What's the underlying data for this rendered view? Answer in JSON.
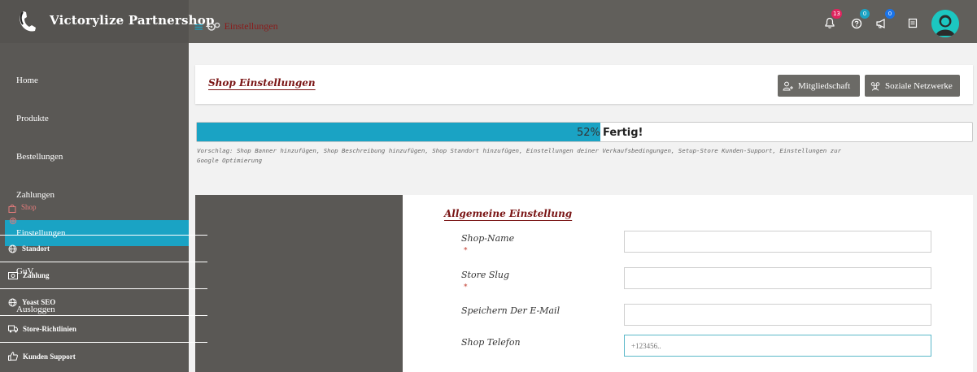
{
  "topbar": {
    "brand_name": "Victorylize Partnershop",
    "breadcrumb": "Einstellungen",
    "icons": [
      {
        "name": "bell-icon",
        "badge": "13",
        "badge_color": "#e0245e"
      },
      {
        "name": "help-icon",
        "badge": "0",
        "badge_color": "#1aa3c4"
      },
      {
        "name": "megaphone-icon",
        "badge": "0",
        "badge_color": "#1a73e8"
      },
      {
        "name": "notes-icon",
        "badge": ""
      }
    ]
  },
  "sidebar": {
    "items": [
      {
        "label": "Home"
      },
      {
        "label": "Produkte"
      },
      {
        "label": "Bestellungen"
      },
      {
        "label": "Zahlungen"
      },
      {
        "label": "Einstellungen",
        "active": true
      },
      {
        "label": "GuV"
      },
      {
        "label": "Ausloggen"
      }
    ]
  },
  "header": {
    "title": "Shop Einstellungen",
    "buttons": [
      {
        "label": "Mitgliedschaft",
        "icon": "user-plus-icon"
      },
      {
        "label": "Soziale Netzwerke",
        "icon": "group-icon"
      }
    ]
  },
  "progress": {
    "percent": 52,
    "percent_text": "52%",
    "label": "Fertig!",
    "hint": "Vorschlag: Shop Banner hinzufügen, Shop Beschreibung hinzufügen, Shop Standort hinzufügen, Einstellungen deiner Verkaufsbedingungen, Setup-Store Kunden-Support, Einstellungen zur Google Optimierung"
  },
  "settings_menu": {
    "items": [
      {
        "label": "Shop",
        "icon": "bag-icon",
        "active": true
      },
      {
        "label": "Standort",
        "icon": "globe-icon"
      },
      {
        "label": "Zahlung",
        "icon": "money-icon"
      },
      {
        "label": "Yoast SEO",
        "icon": "globe-icon"
      },
      {
        "label": "Store-Richtlinien",
        "icon": "truck-icon"
      },
      {
        "label": "Kunden Support",
        "icon": "thumbs-up-icon"
      }
    ]
  },
  "form": {
    "section_title": "Allgemeine Einstellung",
    "fields": [
      {
        "label": "Shop-Name",
        "required": true,
        "value": "",
        "placeholder": ""
      },
      {
        "label": "Store Slug",
        "required": true,
        "value": "",
        "placeholder": ""
      },
      {
        "label": "Speichern Der E-Mail",
        "required": false,
        "value": "",
        "placeholder": ""
      },
      {
        "label": "Shop Telefon",
        "required": false,
        "value": "",
        "placeholder": "+123456.."
      }
    ],
    "required_mark": "*"
  },
  "colors": {
    "accent": "#1aa3c4",
    "title": "#7a1515",
    "sidebar": "#5a5855",
    "topbar": "#615f5b"
  }
}
